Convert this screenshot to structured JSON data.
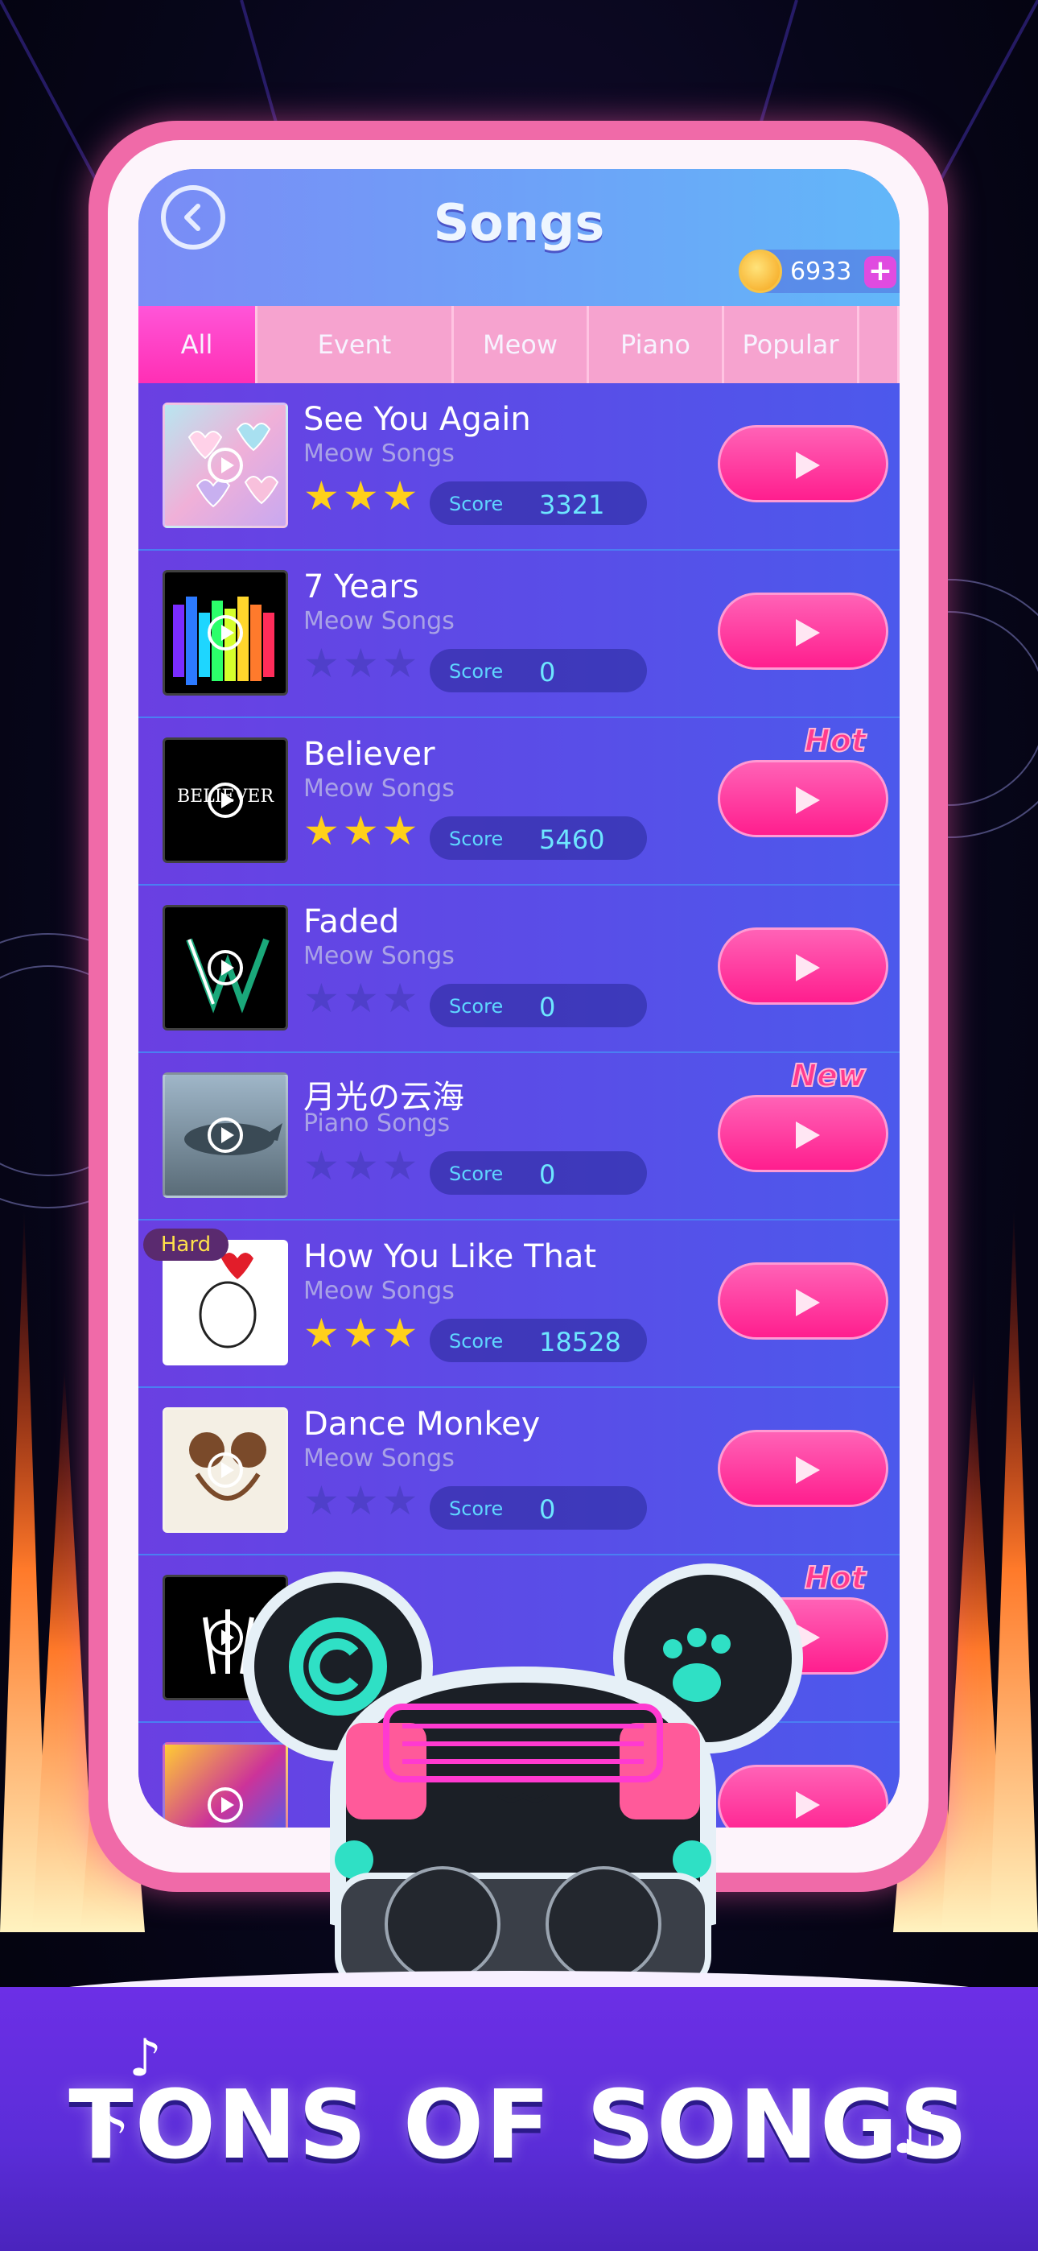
{
  "header": {
    "title": "Songs",
    "coins": "6933",
    "plus_label": "+"
  },
  "tabs": [
    {
      "label": "All",
      "active": true
    },
    {
      "label": "Event",
      "active": false
    },
    {
      "label": "Meow",
      "active": false
    },
    {
      "label": "Piano",
      "active": false
    },
    {
      "label": "Popular",
      "active": false
    }
  ],
  "score_label": "Score",
  "songs": [
    {
      "title": "See You Again",
      "subtitle": "Meow Songs",
      "stars": 3,
      "score": "3321",
      "tag": "",
      "badge": ""
    },
    {
      "title": "7 Years",
      "subtitle": "Meow Songs",
      "stars": 0,
      "score": "0",
      "tag": "",
      "badge": ""
    },
    {
      "title": "Believer",
      "subtitle": "Meow Songs",
      "stars": 3,
      "score": "5460",
      "tag": "Hot",
      "badge": ""
    },
    {
      "title": "Faded",
      "subtitle": "Meow Songs",
      "stars": 0,
      "score": "0",
      "tag": "",
      "badge": ""
    },
    {
      "title": "月光の云海",
      "subtitle": "Piano Songs",
      "stars": 0,
      "score": "0",
      "tag": "New",
      "badge": ""
    },
    {
      "title": "How You Like That",
      "subtitle": "Meow Songs",
      "stars": 3,
      "score": "18528",
      "tag": "",
      "badge": "Hard"
    },
    {
      "title": "Dance Monkey",
      "subtitle": "Meow Songs",
      "stars": 0,
      "score": "0",
      "tag": "",
      "badge": ""
    },
    {
      "title": "",
      "subtitle": "",
      "stars": 0,
      "score": "",
      "tag": "Hot",
      "badge": ""
    },
    {
      "title": "",
      "subtitle": "",
      "stars": 0,
      "score": "",
      "tag": "",
      "badge": ""
    }
  ],
  "covers": {
    "see_you_again_text": "",
    "believer_text": "BELIEVER"
  },
  "banner": {
    "text": "TONS OF SONGS"
  },
  "colors": {
    "phone_frame": "#f06aa8",
    "play_button": "#ff1e8e",
    "star_on": "#ffd01a",
    "tab_active": "#ff2fb4"
  }
}
